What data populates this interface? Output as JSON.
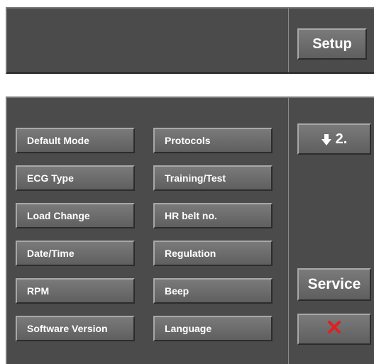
{
  "header": {
    "setup_label": "Setup"
  },
  "menu": {
    "left": [
      {
        "label": "Default Mode"
      },
      {
        "label": "ECG Type"
      },
      {
        "label": "Load Change"
      },
      {
        "label": "Date/Time"
      },
      {
        "label": "RPM"
      },
      {
        "label": "Software Version"
      }
    ],
    "right": [
      {
        "label": "Protocols"
      },
      {
        "label": "Training/Test"
      },
      {
        "label": "HR belt no."
      },
      {
        "label": "Regulation"
      },
      {
        "label": "Beep"
      },
      {
        "label": "Language"
      }
    ]
  },
  "side": {
    "page_label": "2.",
    "page_icon": "arrow-down-icon",
    "service_label": "Service",
    "close_icon": "close-x-icon",
    "close_color": "#e02020"
  }
}
